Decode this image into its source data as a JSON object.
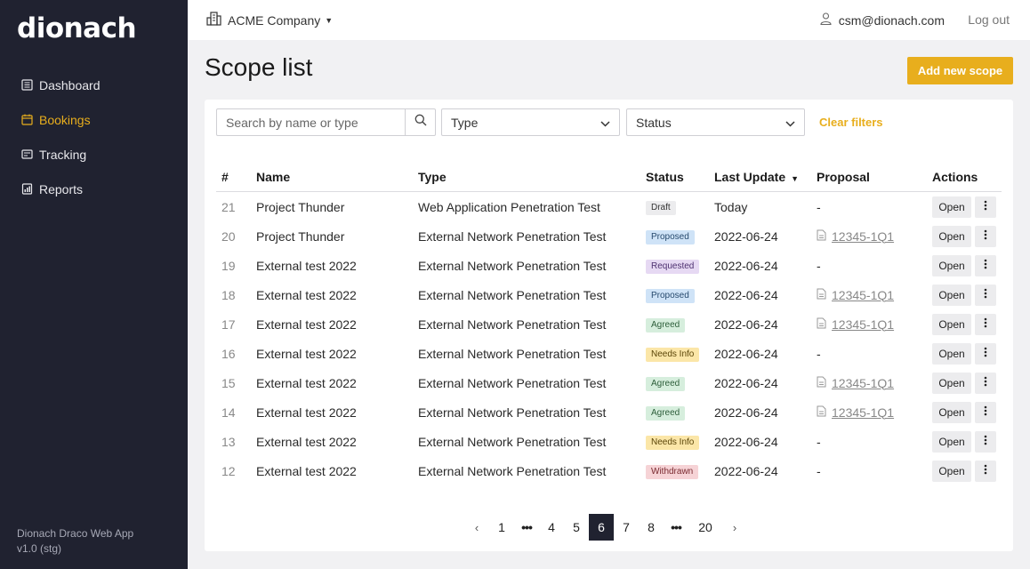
{
  "app": {
    "logo": "dionach",
    "footer_line1": "Dionach Draco Web App",
    "footer_line2": "v1.0 (stg)"
  },
  "sidebar": {
    "items": [
      {
        "label": "Dashboard",
        "icon": "dashboard-icon",
        "active": false
      },
      {
        "label": "Bookings",
        "icon": "calendar-icon",
        "active": true
      },
      {
        "label": "Tracking",
        "icon": "tracking-icon",
        "active": false
      },
      {
        "label": "Reports",
        "icon": "report-icon",
        "active": false
      }
    ]
  },
  "topbar": {
    "company": "ACME Company",
    "user_email": "csm@dionach.com",
    "logout": "Log out"
  },
  "page": {
    "title": "Scope list",
    "add_button": "Add new scope"
  },
  "filters": {
    "search_placeholder": "Search by name or type",
    "type_label": "Type",
    "status_label": "Status",
    "clear_label": "Clear filters"
  },
  "table": {
    "headers": {
      "num": "#",
      "name": "Name",
      "type": "Type",
      "status": "Status",
      "updated": "Last Update",
      "proposal": "Proposal",
      "actions": "Actions"
    },
    "open_label": "Open",
    "rows": [
      {
        "num": "21",
        "name": "Project Thunder",
        "type": "Web Application Penetration Test",
        "status": "Draft",
        "updated": "Today",
        "proposal": "-"
      },
      {
        "num": "20",
        "name": "Project Thunder",
        "type": "External Network Penetration Test",
        "status": "Proposed",
        "updated": "2022-06-24",
        "proposal": "12345-1Q1"
      },
      {
        "num": "19",
        "name": "External test 2022",
        "type": "External Network Penetration Test",
        "status": "Requested",
        "updated": "2022-06-24",
        "proposal": "-"
      },
      {
        "num": "18",
        "name": "External test 2022",
        "type": "External Network Penetration Test",
        "status": "Proposed",
        "updated": "2022-06-24",
        "proposal": "12345-1Q1"
      },
      {
        "num": "17",
        "name": "External test 2022",
        "type": "External Network Penetration Test",
        "status": "Agreed",
        "updated": "2022-06-24",
        "proposal": "12345-1Q1"
      },
      {
        "num": "16",
        "name": "External test 2022",
        "type": "External Network Penetration Test",
        "status": "Needs Info",
        "updated": "2022-06-24",
        "proposal": "-"
      },
      {
        "num": "15",
        "name": "External test 2022",
        "type": "External Network Penetration Test",
        "status": "Agreed",
        "updated": "2022-06-24",
        "proposal": "12345-1Q1"
      },
      {
        "num": "14",
        "name": "External test 2022",
        "type": "External Network Penetration Test",
        "status": "Agreed",
        "updated": "2022-06-24",
        "proposal": "12345-1Q1"
      },
      {
        "num": "13",
        "name": "External test 2022",
        "type": "External Network Penetration Test",
        "status": "Needs Info",
        "updated": "2022-06-24",
        "proposal": "-"
      },
      {
        "num": "12",
        "name": "External test 2022",
        "type": "External Network Penetration Test",
        "status": "Withdrawn",
        "updated": "2022-06-24",
        "proposal": "-"
      }
    ]
  },
  "status_colors": {
    "Draft": {
      "bg": "#ececee",
      "fg": "#333333"
    },
    "Proposed": {
      "bg": "#cfe3f7",
      "fg": "#274a6e"
    },
    "Requested": {
      "bg": "#e6d9f3",
      "fg": "#4d3070"
    },
    "Agreed": {
      "bg": "#d6eedd",
      "fg": "#2d5e3a"
    },
    "Needs Info": {
      "bg": "#fbe6a8",
      "fg": "#5b4508"
    },
    "Withdrawn": {
      "bg": "#f6d3d6",
      "fg": "#7a2a30"
    }
  },
  "pagination": {
    "prev": "‹",
    "next": "›",
    "pages": [
      "1",
      "•••",
      "4",
      "5",
      "6",
      "7",
      "8",
      "•••",
      "20"
    ],
    "current": "6"
  },
  "colors": {
    "accent": "#e8ae1d",
    "sidebar_bg": "#202230"
  }
}
